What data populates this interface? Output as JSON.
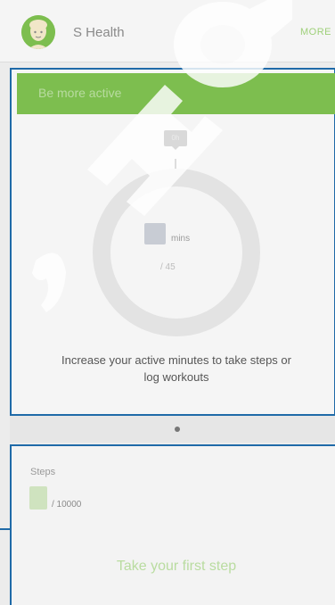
{
  "header": {
    "title": "S Health",
    "more_label": "MORE"
  },
  "active_card": {
    "banner_text": "Be more active",
    "tooltip_text": "0h",
    "unit_label": "mins",
    "goal_label": "/ 45",
    "message": "Increase your active minutes to take steps or log workouts",
    "progress_fraction": 0
  },
  "steps_card": {
    "label": "Steps",
    "goal_label": "/ 10000",
    "cta": "Take your first step"
  },
  "colors": {
    "accent": "#7dbe4f",
    "outline": "#1f6aa8",
    "ring": "#e3e3e3"
  }
}
